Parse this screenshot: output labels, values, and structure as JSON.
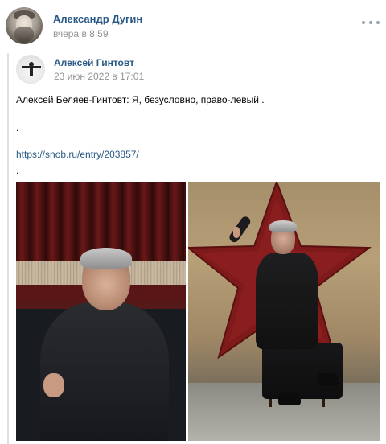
{
  "post": {
    "author_name": "Александр Дугин",
    "time": "вчера в 8:59",
    "more_icon": "more-dots-icon"
  },
  "repost": {
    "author_name": "Алексей Гинтовт",
    "time": "23 июн 2022 в 17:01",
    "text": "Алексей Беляев-Гинтовт: Я, безусловно, право-левый .",
    "dot_1": ".",
    "link": "https://snob.ru/entry/203857/",
    "dot_2": "."
  },
  "colors": {
    "link": "#2a5885",
    "muted": "#939393",
    "repost_border": "#dce1e6"
  }
}
